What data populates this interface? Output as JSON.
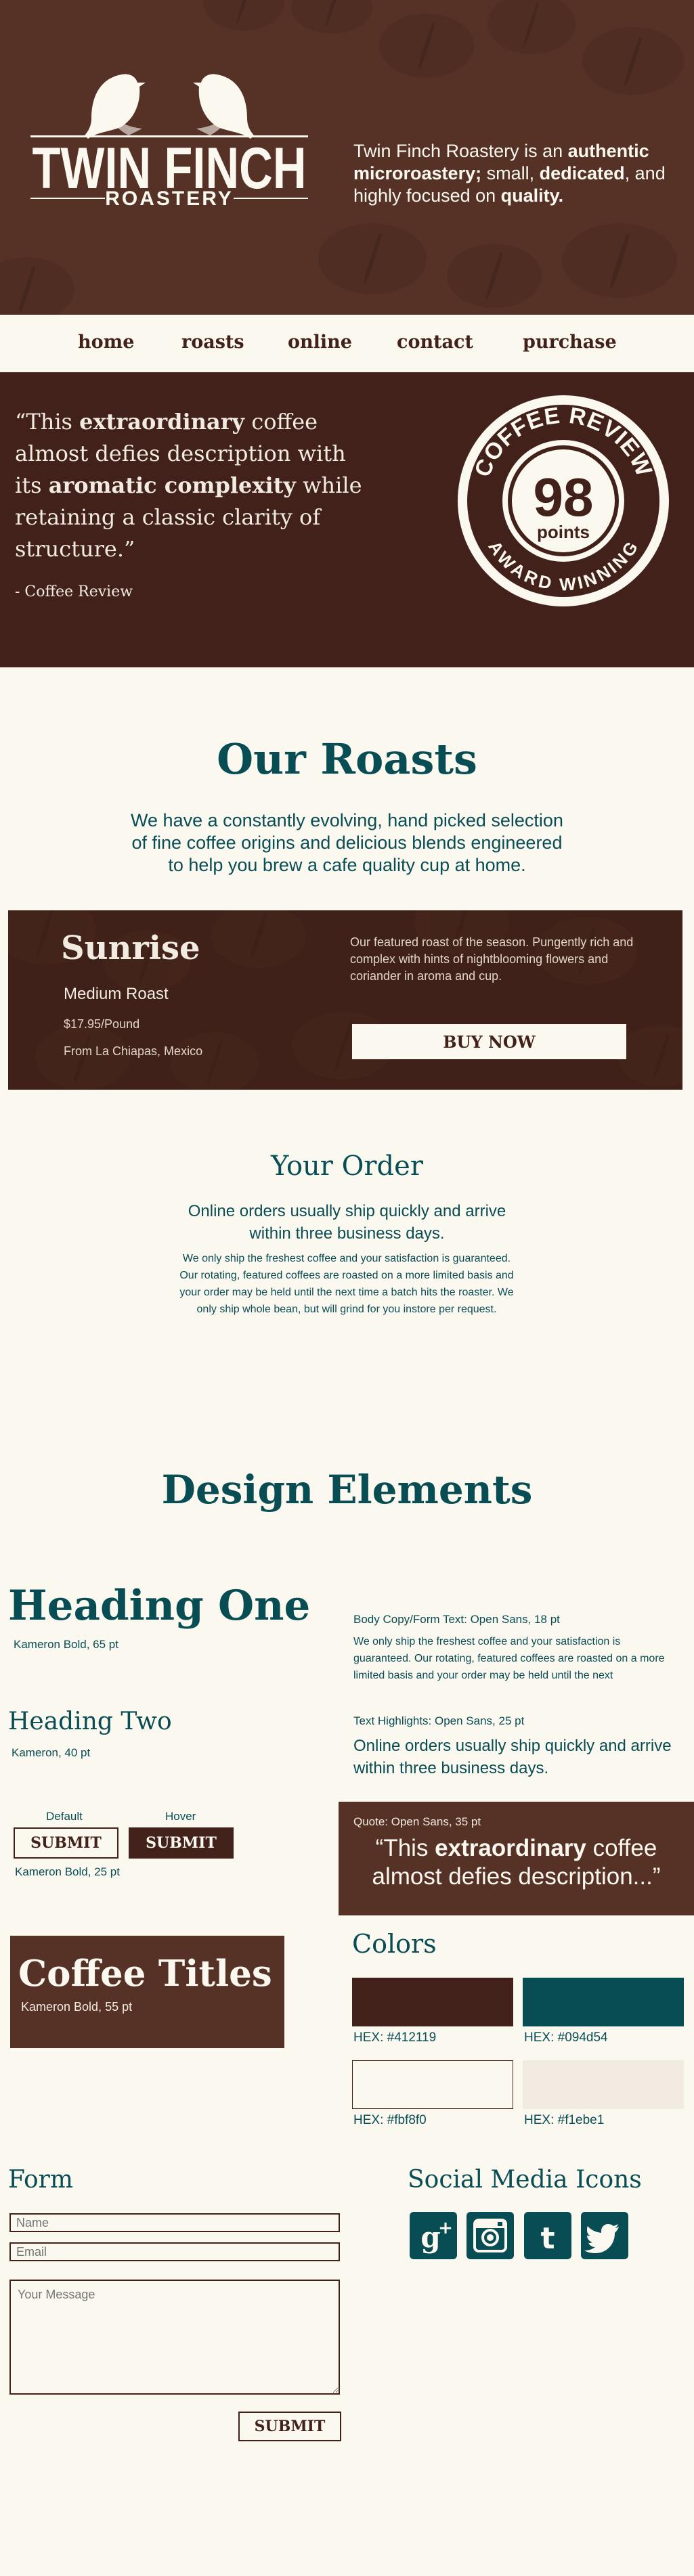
{
  "header": {
    "logo_title": "TWIN FINCH",
    "logo_subtitle": "ROASTERY",
    "tagline_parts": [
      "Twin Finch Roastery is an ",
      "authentic microroastery;",
      " small, ",
      "dedicated",
      ", and highly focused on ",
      "quality."
    ]
  },
  "nav": {
    "items": [
      "home",
      "roasts",
      "online",
      "contact",
      "purchase"
    ]
  },
  "quote_band": {
    "quote_parts": [
      "“This ",
      "extraordinary",
      " coffee almost defies description with its ",
      "aromatic complexity",
      " while retaining a classic clarity of structure.”"
    ],
    "source": "- Coffee Review",
    "badge_top": "COFFEE REVIEW",
    "badge_score": "98",
    "badge_points": "points",
    "badge_bottom": "AWARD WINNING"
  },
  "roasts": {
    "title": "Our Roasts",
    "intro": "We have a constantly evolving, hand picked selection of fine coffee origins and delicious blends engineered to help you brew a cafe quality cup at home.",
    "featured": {
      "name": "Sunrise",
      "roast": "Medium Roast",
      "price": "$17.95/Pound",
      "origin": "From La Chiapas, Mexico",
      "description": "Our featured roast of the season. Pungently rich and complex with hints of nightblooming flowers and coriander in aroma and cup.",
      "buy_label": "BUY NOW"
    }
  },
  "order": {
    "title": "Your Order",
    "highlight": "Online orders usually ship quickly and arrive within three business days.",
    "body": "We only ship the freshest coffee and your satisfaction is guaranteed. Our rotating, featured coffees are roasted on a more limited basis and your order may be held until the next time a batch hits the roaster. We only ship whole bean, but will grind for you instore per request."
  },
  "design": {
    "title": "Design Elements",
    "heading_one": "Heading One",
    "heading_one_note": "Kameron Bold,  65 pt",
    "heading_two": "Heading Two",
    "heading_two_note": "Kameron,  40 pt",
    "body_label": "Body Copy/Form Text: Open Sans,  18 pt",
    "body_sample": "We only ship the freshest coffee and your satisfaction is guaranteed. Our rotating, featured coffees are roasted on a more limited basis and your order may be held until the next",
    "highlight_label": "Text Highlights: Open Sans,  25 pt",
    "highlight_sample": "Online orders usually ship quickly and arrive within three business days.",
    "btn_default_caption": "Default",
    "btn_hover_caption": "Hover",
    "btn_label": "SUBMIT",
    "btn_note": "Kameron Bold, 25 pt",
    "quote_label": "Quote: Open Sans,  35 pt",
    "quote_parts": [
      "“This ",
      "extraordinary",
      " coffee almost defies description...”"
    ],
    "coffee_titles": "Coffee Titles",
    "coffee_titles_note": "Kameron Bold,  55 pt",
    "colors_title": "Colors",
    "colors": [
      {
        "hex": "#412119",
        "label": "HEX: #412119"
      },
      {
        "hex": "#094d54",
        "label": "HEX: #094d54"
      },
      {
        "hex": "#fbf8f0",
        "label": "HEX: #fbf8f0"
      },
      {
        "hex": "#f1ebe1",
        "label": "HEX: #f1ebe1"
      }
    ]
  },
  "form": {
    "title": "Form",
    "name_placeholder": "Name",
    "email_placeholder": "Email",
    "message_placeholder": "Your Message",
    "submit_label": "SUBMIT"
  },
  "social": {
    "title": "Social Media Icons",
    "icons": [
      "google-plus-icon",
      "instagram-icon",
      "tumblr-icon",
      "twitter-icon"
    ]
  }
}
